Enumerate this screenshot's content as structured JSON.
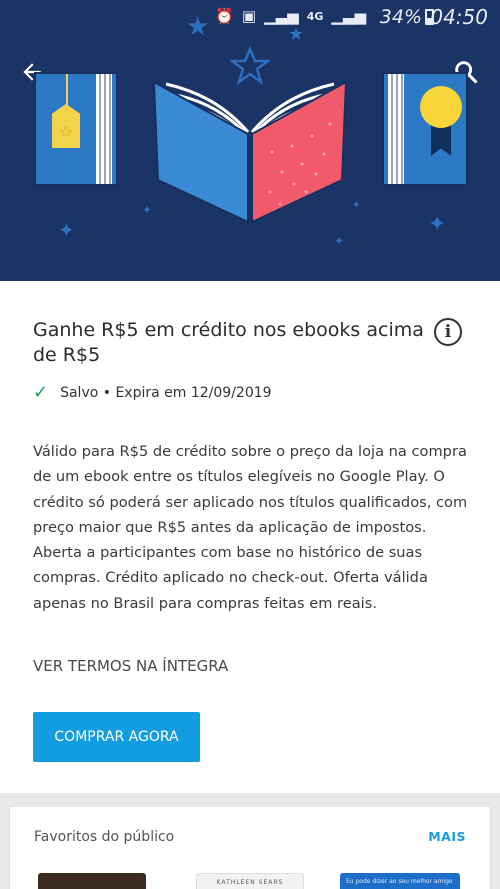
{
  "status_bar": {
    "network": "4G",
    "battery": "34%",
    "time": "04:50"
  },
  "icons": {
    "back": "arrow-left",
    "search": "magnifier",
    "info": "info-circle",
    "check": "check-mark"
  },
  "offer": {
    "title": "Ganhe R$5 em crédito nos ebooks acima de R$5",
    "status": "Salvo • Expira em 12/09/2019",
    "description": "Válido para R$5 de crédito sobre o preço da loja na compra de um ebook entre os títulos elegíveis no Google Play. O crédito só poderá ser aplicado nos títulos qualificados, com preço maior que R$5 antes da aplicação de impostos. Aberta a participantes com base no histórico de suas compras. Crédito aplicado no check-out. Oferta válida apenas no Brasil para compras feitas em reais.",
    "terms_link": "VER TERMOS NA ÍNTEGRA",
    "buy_button": "COMPRAR AGORA"
  },
  "favorites": {
    "title": "Favoritos do público",
    "more": "MAIS",
    "thumb2_text": "KATHLEEN SEARS",
    "thumb3_text": "Eu pode dizer ao seu melhor amigo"
  },
  "colors": {
    "banner_bg": "#1b3466",
    "accent_button": "#129de0",
    "check_green": "#1f9d55"
  }
}
